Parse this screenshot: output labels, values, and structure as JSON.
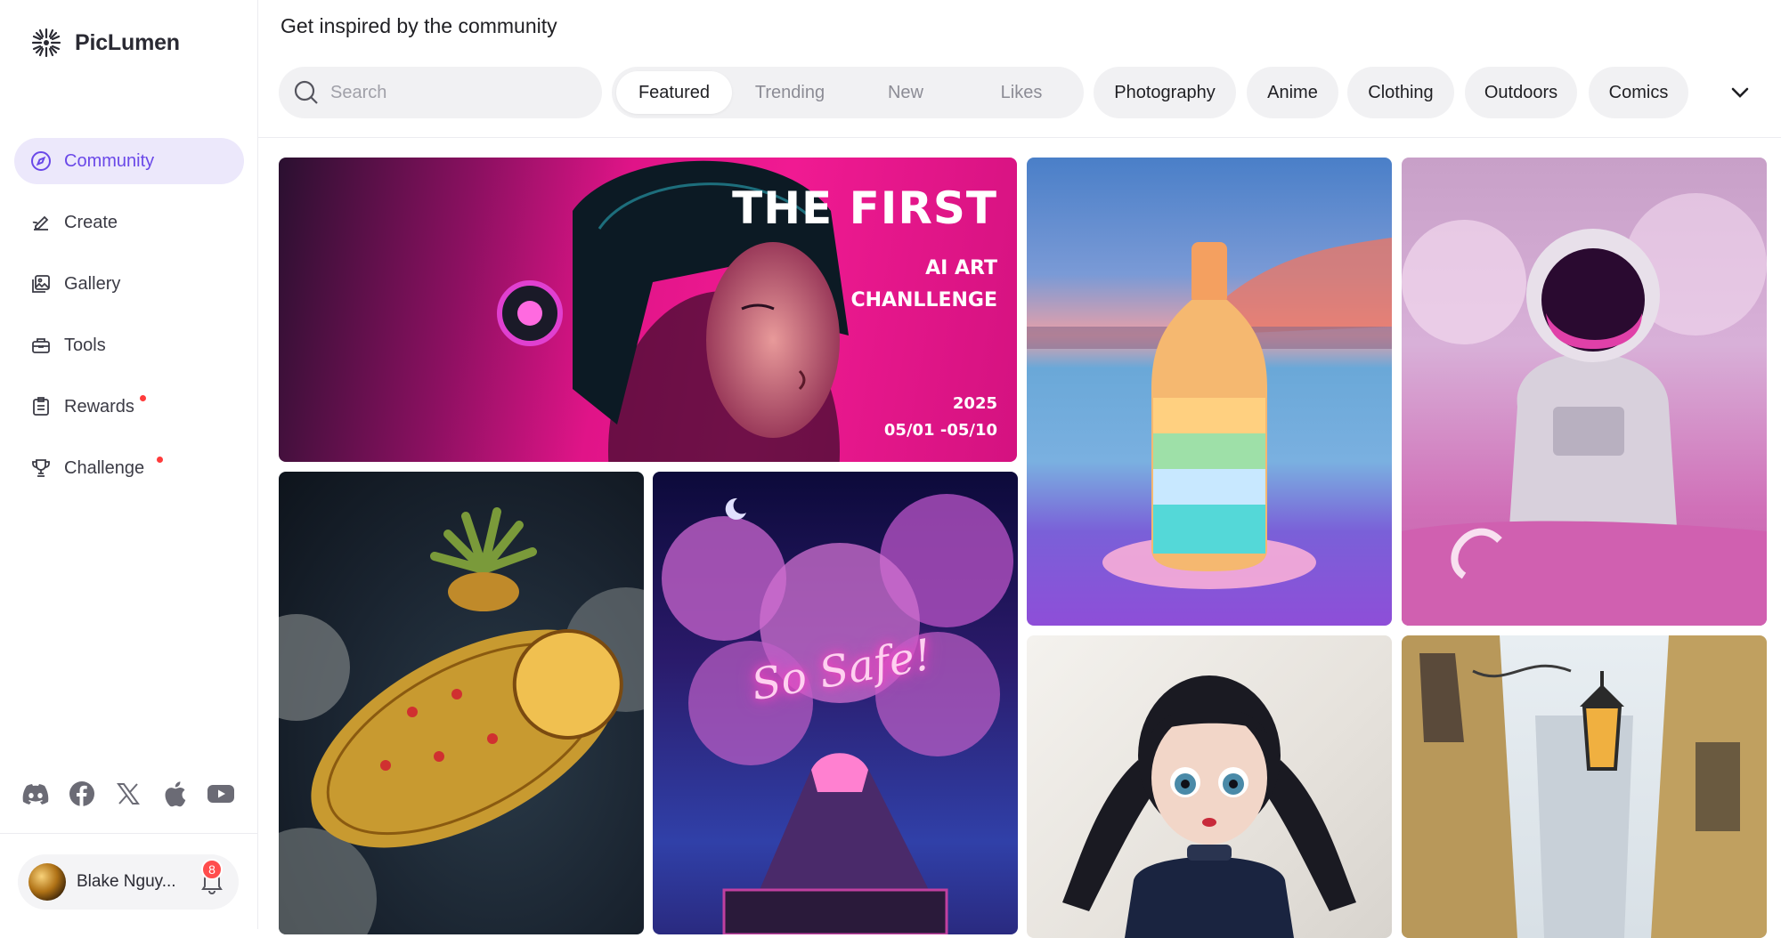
{
  "brand": {
    "name": "PicLumen"
  },
  "sidebar": {
    "items": [
      {
        "label": "Community",
        "icon": "compass-icon",
        "active": true
      },
      {
        "label": "Create",
        "icon": "pen-icon"
      },
      {
        "label": "Gallery",
        "icon": "gallery-icon"
      },
      {
        "label": "Tools",
        "icon": "toolbox-icon"
      },
      {
        "label": "Rewards",
        "icon": "clipboard-icon",
        "dot": true
      },
      {
        "label": "Challenge",
        "icon": "trophy-icon",
        "dot": true
      }
    ],
    "socials": [
      "discord-icon",
      "facebook-icon",
      "x-icon",
      "apple-icon",
      "youtube-icon"
    ]
  },
  "user": {
    "name": "Blake Nguy...",
    "notifications": "8"
  },
  "header": {
    "title": "Get inspired by the community",
    "search_placeholder": "Search",
    "sort_tabs": [
      {
        "label": "Featured",
        "active": true
      },
      {
        "label": "Trending"
      },
      {
        "label": "New"
      },
      {
        "label": "Likes"
      }
    ],
    "categories": [
      "Photography",
      "Anime",
      "Clothing",
      "Outdoors",
      "Comics"
    ]
  },
  "banner": {
    "title": "THE FIRST",
    "line1": "AI ART",
    "line2": "CHANLLENGE",
    "year": "2025",
    "dates": "05/01 -05/10"
  },
  "neon_text": "So Safe!",
  "colors": {
    "accent": "#6a48e8",
    "accent_bg": "#ece8fb",
    "badge": "#ff4d4d"
  }
}
